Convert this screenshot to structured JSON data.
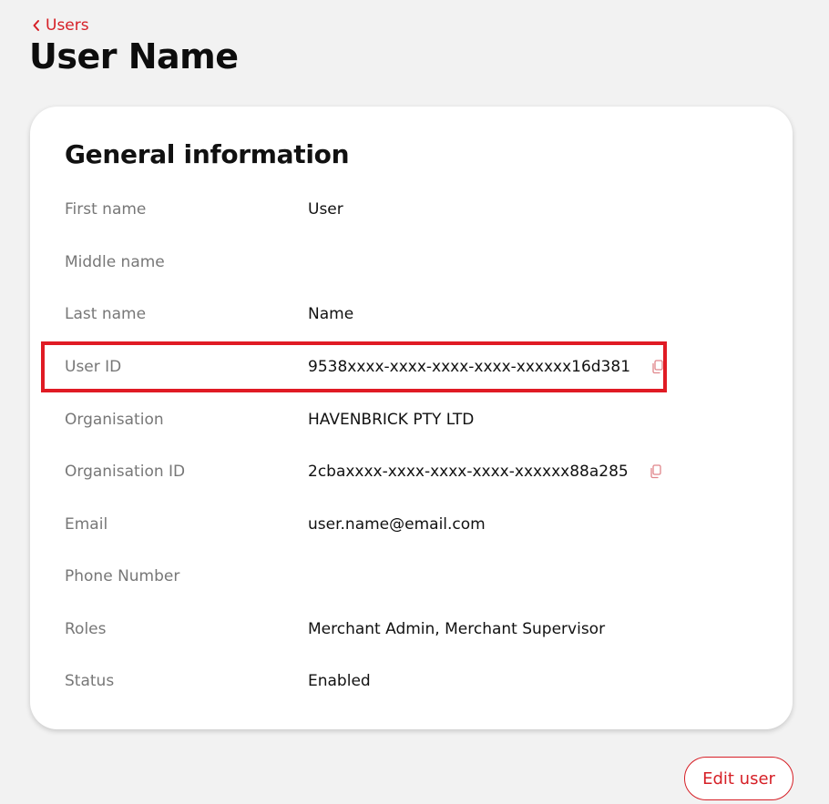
{
  "breadcrumb": {
    "label": "Users"
  },
  "page": {
    "title": "User Name"
  },
  "card": {
    "title": "General information",
    "rows": [
      {
        "label": "First name",
        "value": "User"
      },
      {
        "label": "Middle name",
        "value": ""
      },
      {
        "label": "Last name",
        "value": "Name"
      },
      {
        "label": "User ID",
        "value": "9538xxxx-xxxx-xxxx-xxxx-xxxxxx16d381",
        "copyable": true
      },
      {
        "label": "Organisation",
        "value": "HAVENBRICK PTY LTD"
      },
      {
        "label": "Organisation ID",
        "value": "2cbaxxxx-xxxx-xxxx-xxxx-xxxxxx88a285",
        "copyable": true
      },
      {
        "label": "Email",
        "value": "user.name@email.com"
      },
      {
        "label": "Phone Number",
        "value": ""
      },
      {
        "label": "Roles",
        "value": "Merchant Admin, Merchant Supervisor"
      },
      {
        "label": "Status",
        "value": "Enabled"
      }
    ]
  },
  "actions": {
    "edit_label": "Edit user"
  },
  "colors": {
    "accent": "#d61f26",
    "highlight": "#e01b24",
    "background": "#f2f2f2",
    "label": "#777777"
  },
  "icons": {
    "back": "chevron-left-icon",
    "copy": "copy-icon"
  }
}
